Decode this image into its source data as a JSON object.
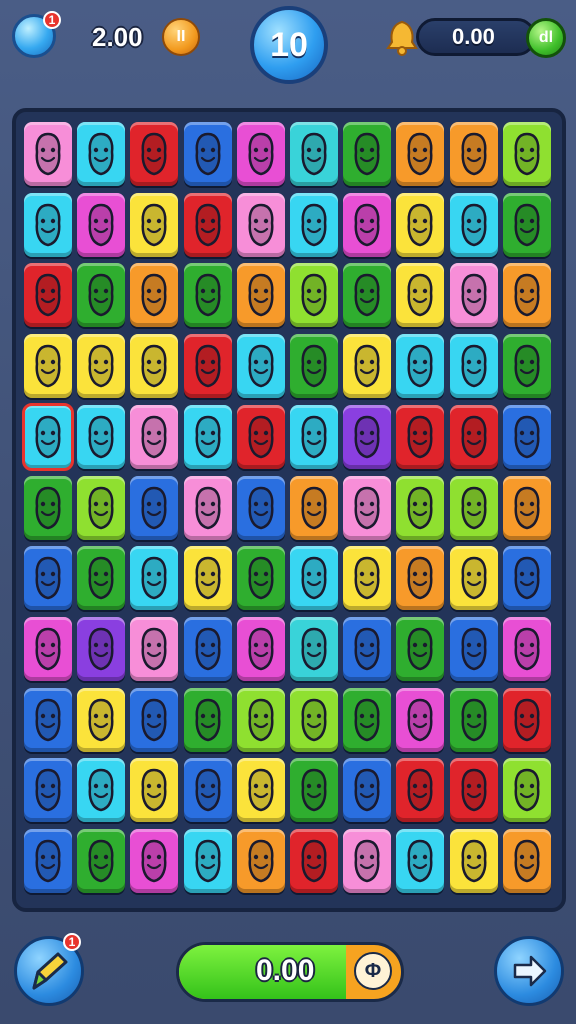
{
  "top_hud": {
    "gem_badge": "1",
    "score": "2.00",
    "coin_symbol": "II",
    "level": "10",
    "bar_value": "0.00",
    "bar_button_symbol": "dl"
  },
  "bottom_hud": {
    "hint_badge": "1",
    "progress_value": "0.00",
    "progress_fraction": 0.75,
    "progress_icon_symbol": "Φ",
    "next_icon": "arrow-right-icon"
  },
  "colors": {
    "pink": "#f78ed8",
    "cyan": "#38d6f2",
    "red": "#e0242b",
    "blue": "#2a6fe0",
    "magenta": "#e84fd4",
    "teal": "#39d3d9",
    "green": "#2fae2f",
    "yellow": "#fbe33b",
    "orange": "#f79a2a",
    "lime": "#8fe030",
    "purple": "#8a3fe0"
  },
  "board": {
    "rows": [
      [
        "pink",
        "cyan",
        "red",
        "blue",
        "magenta",
        "teal",
        "green",
        "orange",
        "orange",
        "lime"
      ],
      [
        "cyan",
        "magenta",
        "yellow",
        "red",
        "pink",
        "cyan",
        "magenta",
        "yellow",
        "cyan",
        "green"
      ],
      [
        "red",
        "green",
        "orange",
        "green",
        "orange",
        "lime",
        "green",
        "yellow",
        "pink",
        "orange"
      ],
      [
        "yellow",
        "yellow",
        "yellow",
        "red",
        "cyan",
        "green",
        "yellow",
        "cyan",
        "cyan",
        "green"
      ],
      [
        "cyan",
        "cyan",
        "pink",
        "cyan",
        "red",
        "cyan",
        "purple",
        "red",
        "red",
        "blue"
      ],
      [
        "green",
        "lime",
        "blue",
        "pink",
        "blue",
        "orange",
        "pink",
        "lime",
        "lime",
        "orange"
      ],
      [
        "blue",
        "green",
        "cyan",
        "yellow",
        "green",
        "cyan",
        "yellow",
        "orange",
        "yellow",
        "blue"
      ],
      [
        "magenta",
        "purple",
        "pink",
        "blue",
        "magenta",
        "teal",
        "blue",
        "green",
        "blue",
        "magenta"
      ],
      [
        "blue",
        "yellow",
        "blue",
        "green",
        "lime",
        "lime",
        "green",
        "magenta",
        "green",
        "red"
      ],
      [
        "blue",
        "cyan",
        "yellow",
        "blue",
        "yellow",
        "green",
        "blue",
        "red",
        "red",
        "lime"
      ],
      [
        "blue",
        "green",
        "magenta",
        "cyan",
        "orange",
        "red",
        "pink",
        "cyan",
        "yellow",
        "orange"
      ]
    ],
    "selected": [
      4,
      0
    ]
  }
}
